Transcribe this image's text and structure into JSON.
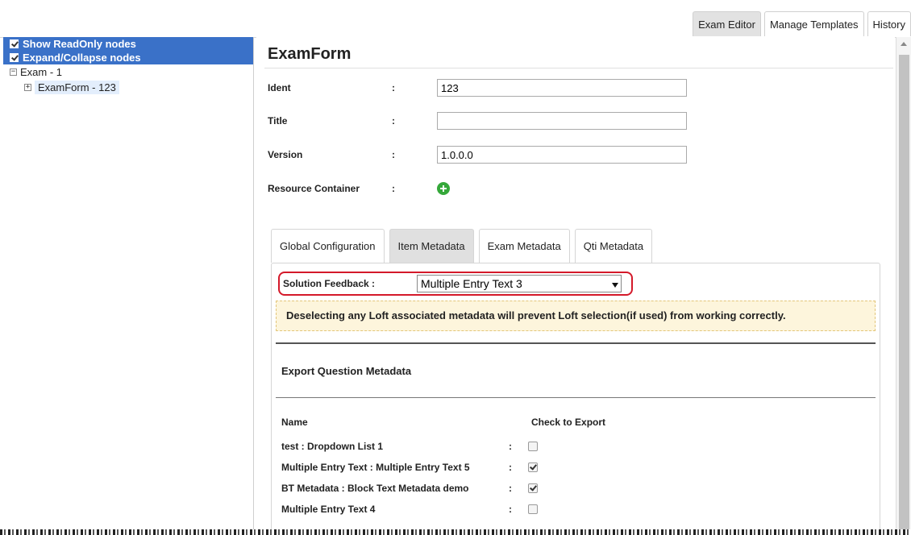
{
  "topnav": {
    "tabs": [
      {
        "label": "Exam Editor",
        "active": true
      },
      {
        "label": "Manage Templates",
        "active": false
      },
      {
        "label": "History",
        "active": false
      }
    ]
  },
  "left": {
    "options": [
      {
        "label": "Show ReadOnly nodes",
        "checked": true
      },
      {
        "label": "Expand/Collapse nodes",
        "checked": true
      }
    ],
    "tree": [
      {
        "label": "Exam - 1",
        "expander": "−"
      },
      {
        "label": "ExamForm - 123",
        "expander": "+"
      }
    ]
  },
  "form": {
    "title": "ExamForm",
    "fields": [
      {
        "label": "Ident",
        "colon": ":",
        "value": "123"
      },
      {
        "label": "Title",
        "colon": ":",
        "value": ""
      },
      {
        "label": "Version",
        "colon": ":",
        "value": "1.0.0.0"
      }
    ],
    "resource_container": {
      "label": "Resource Container",
      "colon": ":",
      "icon": "add-circle-icon"
    }
  },
  "tabs": [
    {
      "label": "Global Configuration",
      "active": false
    },
    {
      "label": "Item Metadata",
      "active": true
    },
    {
      "label": "Exam Metadata",
      "active": false
    },
    {
      "label": "Qti Metadata",
      "active": false
    }
  ],
  "panel": {
    "solution_feedback": {
      "label": "Solution Feedback  :",
      "selected": "Multiple Entry Text 3"
    },
    "warning": "Deselecting any Loft associated metadata will prevent Loft selection(if used) from working correctly.",
    "section_title": "Export Question Metadata",
    "col_name": "Name",
    "col_export": "Check to Export",
    "rows": [
      {
        "name": "test : Dropdown List 1",
        "colon": ":",
        "checked": false
      },
      {
        "name": "Multiple Entry Text : Multiple Entry Text 5",
        "colon": ":",
        "checked": true
      },
      {
        "name": "BT Metadata : Block Text Metadata demo",
        "colon": ":",
        "checked": true
      },
      {
        "name": "Multiple Entry Text 4",
        "colon": ":",
        "checked": false
      }
    ]
  },
  "colors": {
    "option_bg": "#3a71c8",
    "highlight_border": "#d4192a",
    "warning_bg": "#fdf5dc",
    "add_icon": "#35a83a"
  }
}
